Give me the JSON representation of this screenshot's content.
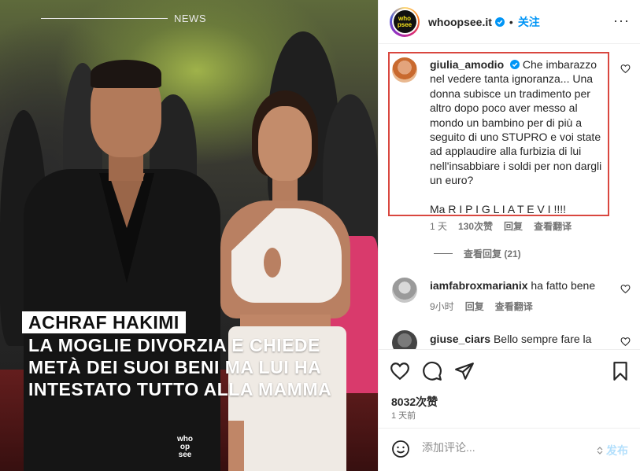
{
  "media": {
    "news_tag": "NEWS",
    "headline_name": "ACHRAF HAKIMI",
    "headline_lines": [
      "LA MOGLIE DIVORZIA E CHIEDE",
      "METÀ DEI SUOI BENI MA LUI HA",
      "INTESTATO TUTTO ALLA MAMMA"
    ],
    "watermark": [
      "who",
      "op",
      "see"
    ]
  },
  "header": {
    "avatar_text": [
      "who",
      "psee"
    ],
    "username": "whoopsee.it",
    "separator": "•",
    "follow_label": "关注",
    "more_label": "···"
  },
  "comments": [
    {
      "username": "giulia_amodio",
      "verified": true,
      "text": "Che imbarazzo nel vedere tanta ignoranza... Una donna subisce un tradimento per altro dopo poco aver messo al mondo un bambino per di più a seguito di uno STUPRO e voi state ad applaudire alla furbizia di lui nell'insabbiare i soldi per non dargli un euro?",
      "text2": "Ma R I P I G L I A T E V I !!!!",
      "time": "1 天",
      "likes": "130次赞",
      "reply": "回复",
      "translate": "查看翻译",
      "view_replies": "查看回复 (21)"
    },
    {
      "username": "iamfabroxmarianix",
      "text": "ha fatto bene",
      "time": "9小时",
      "reply": "回复",
      "translate": "查看翻译"
    },
    {
      "username": "giuse_ciars",
      "text": "Bello sempre fare la"
    }
  ],
  "actions": {
    "likes": "8032次赞",
    "time": "1 天前"
  },
  "add_comment": {
    "placeholder": "添加评论...",
    "post_label": "发布"
  },
  "colors": {
    "accent": "#0095f6",
    "highlight_border": "#d9473f",
    "muted": "#737373"
  }
}
